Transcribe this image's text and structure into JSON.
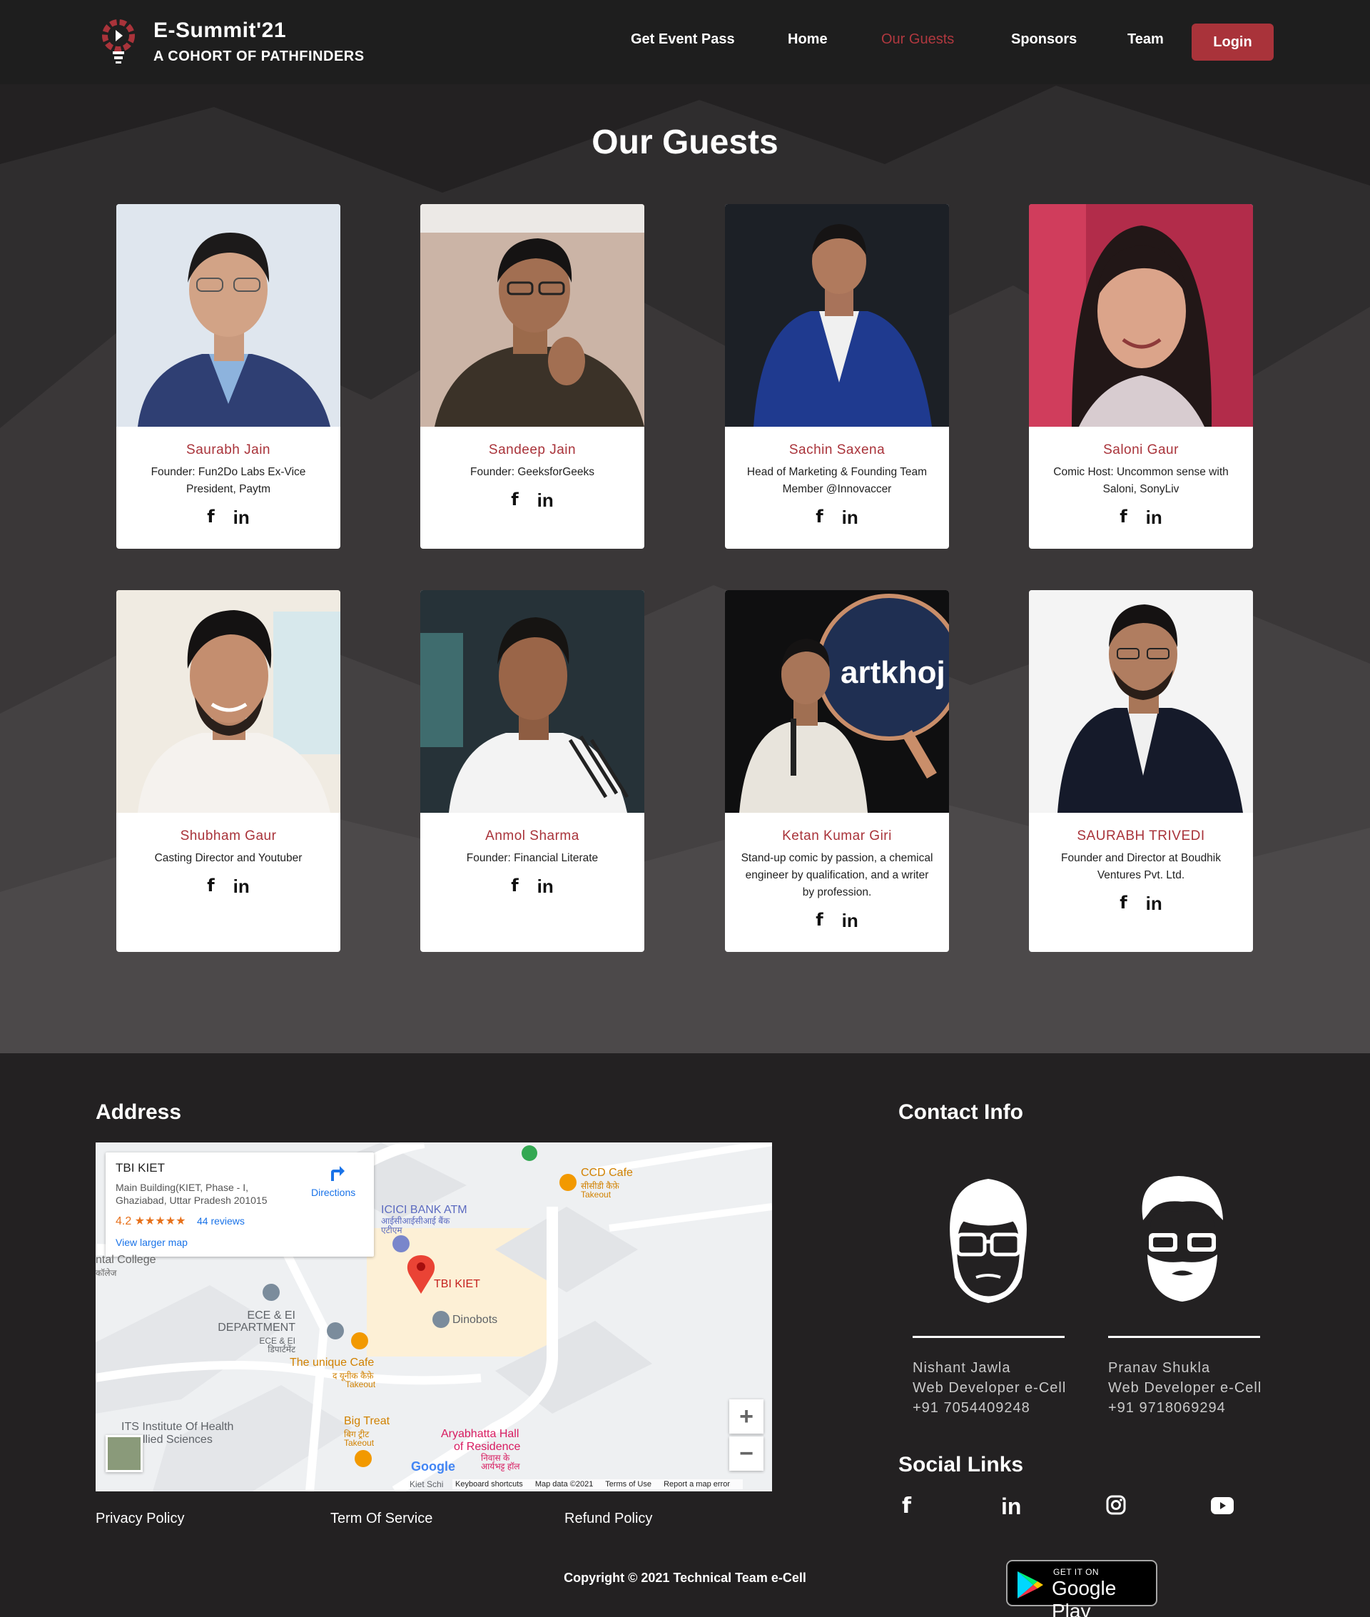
{
  "nav": {
    "brand_title": "E-Summit'21",
    "brand_subtitle": "A COHORT OF PATHFINDERS",
    "links": [
      {
        "label": "Get Event Pass",
        "active": false
      },
      {
        "label": "Home",
        "active": false
      },
      {
        "label": "Our Guests",
        "active": true
      },
      {
        "label": "Sponsors",
        "active": false
      },
      {
        "label": "Team",
        "active": false
      }
    ],
    "login_label": "Login"
  },
  "guests": {
    "title": "Our Guests",
    "cards": [
      {
        "name": "Saurabh Jain",
        "role": "Founder: Fun2Do Labs Ex-Vice President, Paytm"
      },
      {
        "name": "Sandeep Jain",
        "role": "Founder: GeeksforGeeks"
      },
      {
        "name": "Sachin Saxena",
        "role": "Head of Marketing & Founding Team Member @Innovaccer"
      },
      {
        "name": "Saloni Gaur",
        "role": "Comic Host: Uncommon sense with Saloni, SonyLiv"
      },
      {
        "name": "Shubham Gaur",
        "role": "Casting Director and Youtuber"
      },
      {
        "name": "Anmol Sharma",
        "role": "Founder: Financial Literate"
      },
      {
        "name": "Ketan Kumar Giri",
        "role": "Stand-up comic by passion, a chemical engineer by qualification, and a writer by profession."
      },
      {
        "name": "SAURABH TRIVEDI",
        "role": "Founder and Director at Boudhik Ventures Pvt. Ltd."
      }
    ],
    "social_fb": "f",
    "social_in": "in"
  },
  "footer": {
    "address_heading": "Address",
    "map": {
      "place_title": "TBI KIET",
      "place_address": "Main Building(KIET, Phase - I, Ghaziabad, Uttar Pradesh 201015",
      "rating": "4.2",
      "stars": "★★★★★",
      "reviews": "44 reviews",
      "larger_map": "View larger map",
      "directions": "Directions",
      "labels": {
        "ccd": "CCD Cafe",
        "ccd_hi": "सीसीडी कैफ़े",
        "ccd_takeout": "Takeout",
        "icici": "ICICI BANK ATM",
        "icici_hi": "आईसीआईसीआई बैंक एटीएम",
        "college": "ntal College",
        "college_hi": "कॉलेज",
        "tbi": "TBI KIET",
        "dinobots": "Dinobots",
        "ece": "ECE & EI DEPARTMENT",
        "ece_hi": "ECE & EI डिपार्टमेंट",
        "unique": "The unique Cafe",
        "unique_hi": "द यूनीक कैफ़े",
        "unique_takeout": "Takeout",
        "its": "ITS Institute Of Health",
        "its2": "llied Sciences",
        "bigtreat": "Big Treat",
        "bigtreat_hi": "बिग ट्रीट",
        "bigtreat_takeout": "Takeout",
        "aryabhatta": "Aryabhatta Hall",
        "aryabhatta2": "of Residence",
        "aryabhatta_hi": "निवास के आर्यभट्ट हॉल",
        "kiet_school": "Kiet Schi"
      },
      "zoom_in": "+",
      "zoom_out": "−",
      "google": "Google",
      "footer_items": [
        "Keyboard shortcuts",
        "Map data ©2021",
        "Terms of Use",
        "Report a map error"
      ]
    },
    "policies": [
      "Privacy Policy",
      "Term Of Service",
      "Refund Policy"
    ],
    "copyright": "Copyright © 2021 Technical Team e-Cell",
    "contact_heading": "Contact Info",
    "contacts": [
      {
        "name": "Nishant Jawla",
        "title": "Web Developer e-Cell",
        "phone": "+91 7054409248"
      },
      {
        "name": "Pranav Shukla",
        "title": "Web Developer e-Cell",
        "phone": "+91 9718069294"
      }
    ],
    "social_heading": "Social Links",
    "social_icons": [
      "facebook-icon",
      "linkedin-icon",
      "instagram-icon",
      "youtube-icon"
    ],
    "gplay_small": "GET IT ON",
    "gplay_big": "Google Play"
  },
  "colors": {
    "accent": "#a9333a",
    "nav_bg": "#1e1e1e",
    "footer_bg": "#232122"
  }
}
